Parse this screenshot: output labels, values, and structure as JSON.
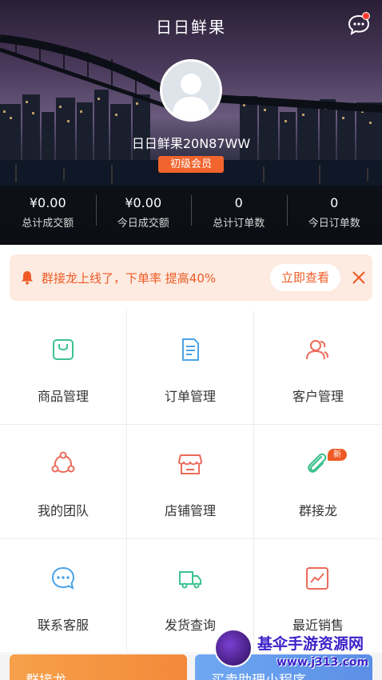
{
  "header": {
    "title": "日日鲜果"
  },
  "profile": {
    "name": "日日鲜果20N87WW",
    "level": "初级会员"
  },
  "stats": [
    {
      "value": "¥0.00",
      "label": "总计成交额"
    },
    {
      "value": "¥0.00",
      "label": "今日成交额"
    },
    {
      "value": "0",
      "label": "总计订单数"
    },
    {
      "value": "0",
      "label": "今日订单数"
    }
  ],
  "notice": {
    "text": "群接龙上线了，下单率 提高40%",
    "button": "立即查看"
  },
  "grid": [
    {
      "label": "商品管理",
      "icon": "shopping-bag-icon"
    },
    {
      "label": "订单管理",
      "icon": "document-icon"
    },
    {
      "label": "客户管理",
      "icon": "users-icon"
    },
    {
      "label": "我的团队",
      "icon": "team-icon"
    },
    {
      "label": "店铺管理",
      "icon": "store-icon"
    },
    {
      "label": "群接龙",
      "icon": "paperclip-icon",
      "badge": "新"
    },
    {
      "label": "联系客服",
      "icon": "chat-icon"
    },
    {
      "label": "发货查询",
      "icon": "truck-icon"
    },
    {
      "label": "最近销售",
      "icon": "chart-icon"
    }
  ],
  "bottom_cards": [
    {
      "label": "群接龙"
    },
    {
      "label": "买卖助理小程序"
    }
  ],
  "watermark": {
    "title": "基伞手游资源网",
    "url": "www.j313.com"
  },
  "colors": {
    "accent": "#ee5a24",
    "badge": "#f2642d",
    "notice_bg": "#fdebe1"
  }
}
